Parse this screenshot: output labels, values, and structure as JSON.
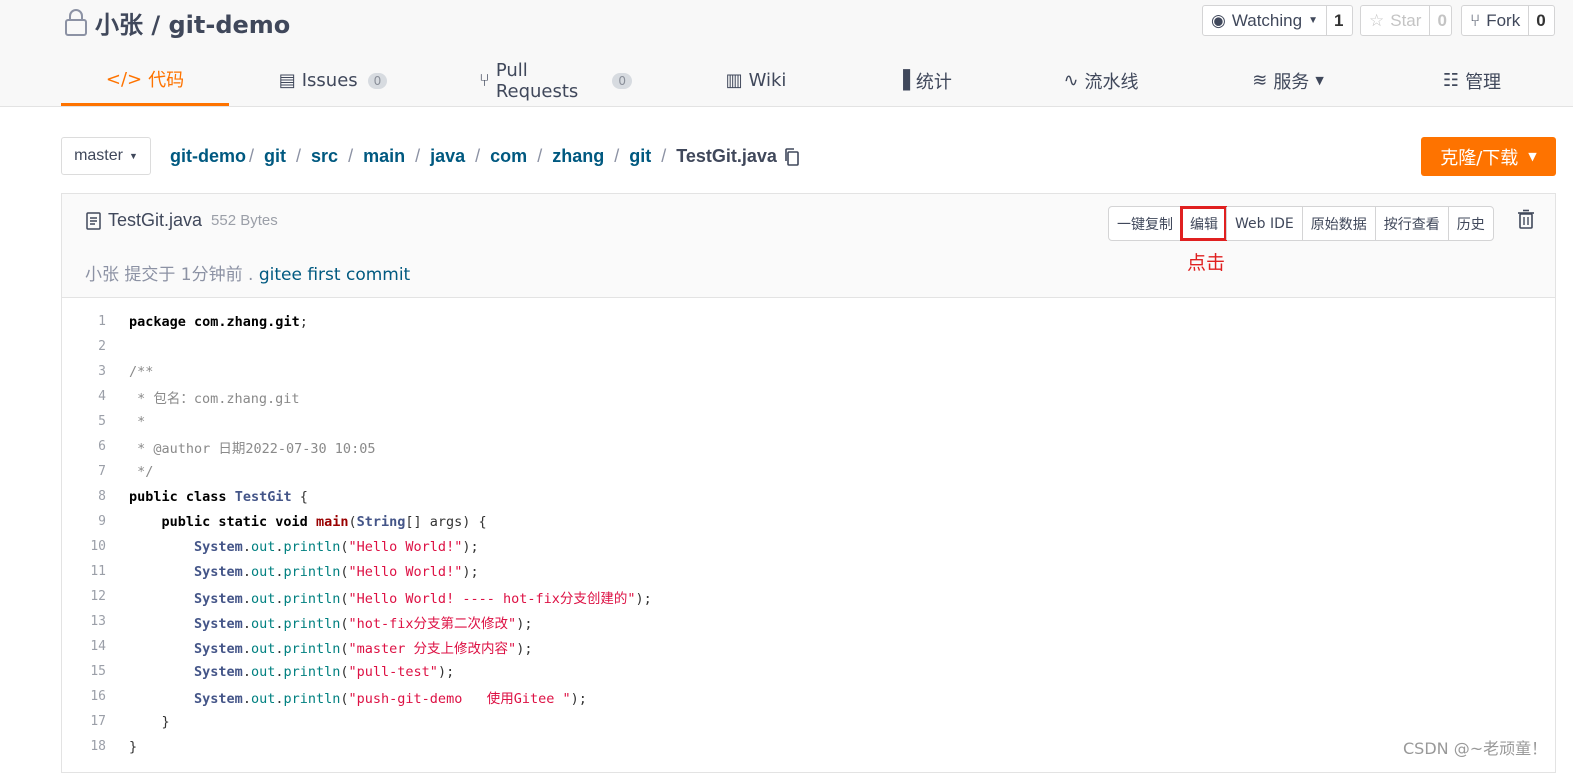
{
  "repo": {
    "title": "小张 / git-demo"
  },
  "social": {
    "watch_label": "Watching",
    "watch_count": "1",
    "star_label": "Star",
    "star_count": "0",
    "fork_label": "Fork",
    "fork_count": "0"
  },
  "tabs": [
    {
      "label": "代码",
      "icon": "code-icon",
      "active": true
    },
    {
      "label": "Issues",
      "badge": "0",
      "icon": "issues-icon"
    },
    {
      "label": "Pull Requests",
      "badge": "0",
      "icon": "pull-request-icon"
    },
    {
      "label": "Wiki",
      "icon": "wiki-book-icon"
    },
    {
      "label": "统计",
      "icon": "bar-chart-icon"
    },
    {
      "label": "流水线",
      "icon": "pipeline-icon"
    },
    {
      "label": "服务",
      "icon": "pulse-icon"
    },
    {
      "label": "管理",
      "icon": "manage-icon"
    }
  ],
  "branch": {
    "name": "master"
  },
  "breadcrumb": [
    "git-demo",
    "git",
    "src",
    "main",
    "java",
    "com",
    "zhang",
    "git",
    "TestGit.java"
  ],
  "clone_label": "克隆/下载",
  "file": {
    "name": "TestGit.java",
    "size": "552 Bytes",
    "commit_author": "小张",
    "commit_text": " 提交于 1分钟前 . ",
    "commit_message": "gitee first commit"
  },
  "actions": [
    "一键复制",
    "编辑",
    "Web IDE",
    "原始数据",
    "按行查看",
    "历史"
  ],
  "annotation": "点击",
  "code": {
    "line_numbers": [
      "1",
      "2",
      "3",
      "4",
      "5",
      "6",
      "7",
      "8",
      "9",
      "10",
      "11",
      "12",
      "13",
      "14",
      "15",
      "16",
      "17",
      "18"
    ],
    "pkg_kw": "package",
    "pkg_name": " com.zhang.git",
    "c1": "/**",
    "c2": " * 包名：com.zhang.git",
    "c3": " *",
    "c4": " * @author 日期2022-07-30 10:05",
    "c5": " */",
    "cls_kw": "public class",
    "cls_name": "TestGit",
    "main_kw": "public static void",
    "main_fn": "main",
    "main_type": "String",
    "main_args": "[] args) {",
    "sys": "System",
    "out": "out",
    "println": "println",
    "s1": "\"Hello World!\"",
    "s2": "\"Hello World!\"",
    "s3": "\"Hello World! ---- hot-fix分支创建的\"",
    "s4": "\"hot-fix分支第二次修改\"",
    "s5": "\"master 分支上修改内容\"",
    "s6": "\"pull-test\"",
    "s7": "\"push-git-demo   使用Gitee \""
  },
  "watermark": "CSDN @~老顽童！"
}
